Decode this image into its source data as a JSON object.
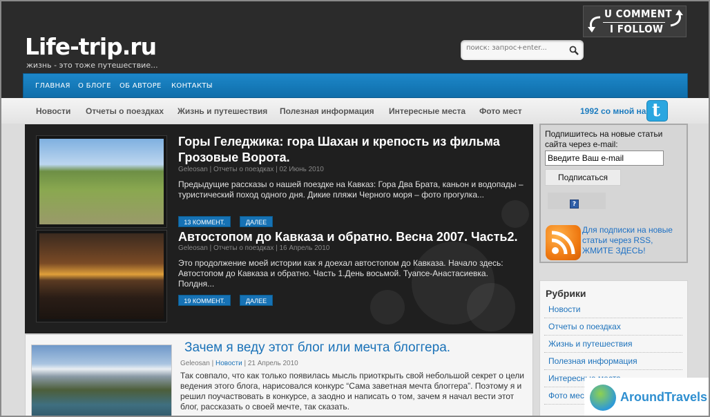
{
  "header": {
    "site_title": "Life-trip.ru",
    "tagline": "жизнь - это тоже путешествие...",
    "ucomment_line1": "U COMMENT",
    "ucomment_line2": "I FOLLOW",
    "search_placeholder": "поиск: запрос+enter..."
  },
  "nav": {
    "items": [
      {
        "label": "ГЛАВНАЯ"
      },
      {
        "label": "О БЛОГЕ"
      },
      {
        "label": "ОБ АВТОРЕ"
      },
      {
        "label": "КОНТАКТЫ"
      }
    ]
  },
  "subnav": {
    "items": [
      {
        "label": "Новости"
      },
      {
        "label": "Отчеты о поездках"
      },
      {
        "label": "Жизнь и путешествия"
      },
      {
        "label": "Полезная информация"
      },
      {
        "label": "Интересные места"
      },
      {
        "label": "Фото мест"
      }
    ],
    "twitter_text": "1992 со мной на"
  },
  "featured": [
    {
      "title": "Горы Геледжика: гора Шахан и крепость из фильма Грозовые Ворота.",
      "author": "Geleosan",
      "category": "Отчеты о поездках",
      "date": "02 Июнь 2010",
      "excerpt": "Предыдущие рассказы о нашей поездке на Кавказ: Гора Два Брата, каньон и водопады – туристический поход одного дня. Дикие пляжи Черного моря – фото прогулка...",
      "comments_label": "13 КОММЕНТ.",
      "more_label": "ДАЛЕЕ"
    },
    {
      "title": "Автостопом до Кавказа и обратно. Весна 2007. Часть2.",
      "author": "Geleosan",
      "category": "Отчеты о поездках",
      "date": "16 Апрель 2010",
      "excerpt": "Это продолжение моей истории как я доехал автостопом до Кавказа. Начало здесь: Автостопом до Кавказа и обратно. Часть   1.День восьмой. Туапсе-Анастасиевка. Полдня...",
      "comments_label": "19 КОММЕНТ.",
      "more_label": "ДАЛЕЕ"
    }
  ],
  "post": {
    "title": "Зачем я веду этот блог или мечта блоггера.",
    "author": "Geleosan",
    "category": "Новости",
    "date": "21 Апрель 2010",
    "excerpt": "Так совпало, что как только появилась мысль приоткрыть свой небольшой секрет о цели ведения этого блога, нарисовался конкурс “Сама заветная мечта блоггера”. Поэтому я и решил поучаствовать в конкурсе, а заодно и написать о том, зачем я начал вести этот блог, рассказать о своей мечте, так сказать."
  },
  "subscribe": {
    "text": "Подпишитесь на новые статьи сайта через e-mail:",
    "email_value": "Введите Ваш e-mail",
    "button_label": "Подписаться",
    "help_label": "?",
    "rss_text": "Для подписки на новые статьи через RSS, ЖМИТЕ ЗДЕСЬ!"
  },
  "rubrics": {
    "title": "Рубрики",
    "items": [
      {
        "label": "Новости"
      },
      {
        "label": "Отчеты о поездках"
      },
      {
        "label": "Жизнь и путешествия"
      },
      {
        "label": "Полезная информация"
      },
      {
        "label": "Интересные места"
      },
      {
        "label": "Фото мест"
      }
    ]
  },
  "watermark": {
    "text": "AroundTravels"
  },
  "colors": {
    "nav_blue": "#1672b5",
    "link_blue": "#1d72bb",
    "header_dark": "#2b2b2b",
    "rss_orange": "#f07b13"
  }
}
